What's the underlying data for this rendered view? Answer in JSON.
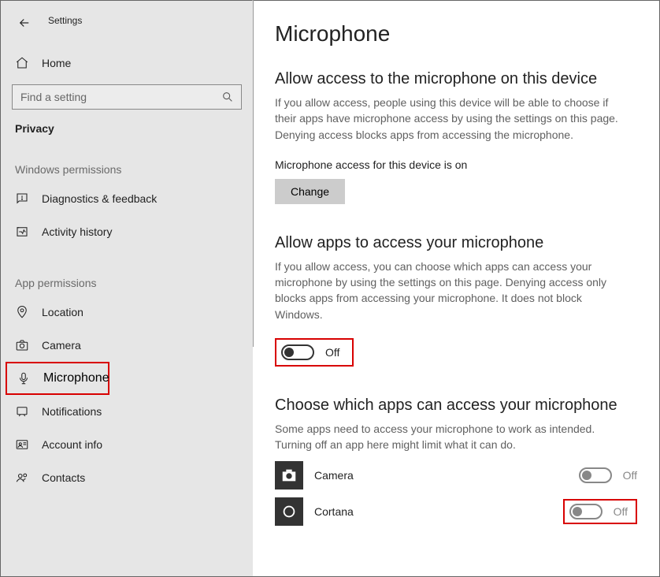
{
  "header": {
    "app_title": "Settings",
    "home_label": "Home"
  },
  "search": {
    "placeholder": "Find a setting"
  },
  "sidebar": {
    "privacy_label": "Privacy",
    "head_windows": "Windows permissions",
    "head_app": "App permissions",
    "items": {
      "diagnostics": "Diagnostics & feedback",
      "activity": "Activity history",
      "location": "Location",
      "camera": "Camera",
      "microphone": "Microphone",
      "notifications": "Notifications",
      "account": "Account info",
      "contacts": "Contacts"
    }
  },
  "main": {
    "page_title": "Microphone",
    "s1": {
      "title": "Allow access to the microphone on this device",
      "desc": "If you allow access, people using this device will be able to choose if their apps have microphone access by using the settings on this page. Denying access blocks apps from accessing the microphone.",
      "status": "Microphone access for this device is on",
      "change_btn": "Change"
    },
    "s2": {
      "title": "Allow apps to access your microphone",
      "desc": "If you allow access, you can choose which apps can access your microphone by using the settings on this page. Denying access only blocks apps from accessing your microphone. It does not block Windows.",
      "toggle_label": "Off"
    },
    "s3": {
      "title": "Choose which apps can access your microphone",
      "desc": "Some apps need to access your microphone to work as intended. Turning off an app here might limit what it can do.",
      "apps": {
        "camera": {
          "name": "Camera",
          "state": "Off"
        },
        "cortana": {
          "name": "Cortana",
          "state": "Off"
        }
      }
    }
  }
}
